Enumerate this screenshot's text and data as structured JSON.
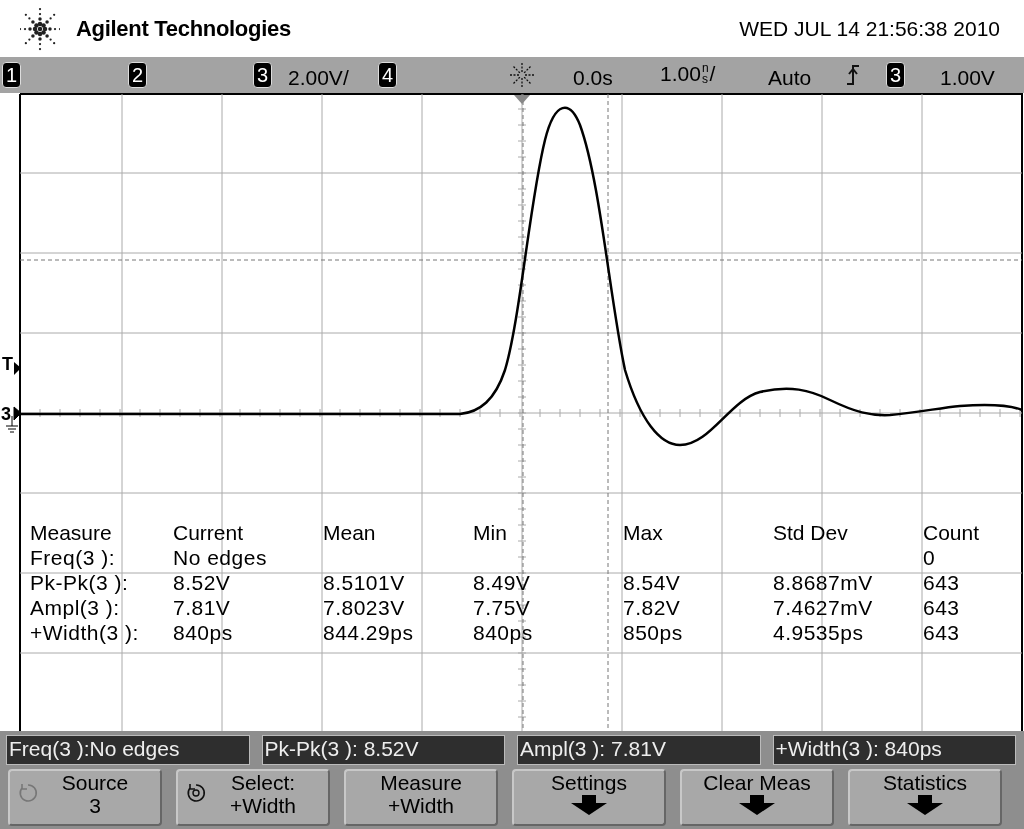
{
  "header": {
    "brand": "Agilent Technologies",
    "datetime": "WED JUL 14 21:56:38 2010"
  },
  "status_bar": {
    "channels": [
      {
        "label": "1"
      },
      {
        "label": "2"
      },
      {
        "label": "3",
        "scale": "2.00V/"
      },
      {
        "label": "4"
      }
    ],
    "time_offset": "0.0s",
    "time_scale": {
      "value": "1.00",
      "prefix": "n",
      "unit": "s",
      "suffix": "/"
    },
    "trigger_mode": "Auto",
    "trigger_source": "3",
    "trigger_level": "1.00V"
  },
  "graticule": {
    "trigger_marker": "T",
    "channel_marker": "3"
  },
  "measurements": {
    "columns": [
      "Measure",
      "Current",
      "Mean",
      "Min",
      "Max",
      "Std Dev",
      "Count"
    ],
    "rows": [
      [
        "Freq(3 ):",
        "No edges",
        null,
        null,
        null,
        null,
        "0"
      ],
      [
        "Pk-Pk(3 ):",
        "8.52V",
        "8.5101V",
        "8.49V",
        "8.54V",
        "8.8687mV",
        "643"
      ],
      [
        "Ampl(3 ):",
        "7.81V",
        "7.8023V",
        "7.75V",
        "7.82V",
        "7.4627mV",
        "643"
      ],
      [
        "+Width(3 ):",
        "840ps",
        "844.29ps",
        "840ps",
        "850ps",
        "4.9535ps",
        "643"
      ]
    ]
  },
  "readouts": [
    "Freq(3 ):No edges",
    "Pk-Pk(3 ): 8.52V",
    "Ampl(3 ): 7.81V",
    "+Width(3 ): 840ps"
  ],
  "softkeys": [
    {
      "kind": "knob-dim",
      "line1": "Source",
      "line2": "3"
    },
    {
      "kind": "knob",
      "line1": "Select:",
      "line2": "+Width"
    },
    {
      "kind": "plain",
      "line1": "Measure",
      "line2": "+Width"
    },
    {
      "kind": "menu",
      "line1": "Settings"
    },
    {
      "kind": "menu",
      "line1": "Clear Meas"
    },
    {
      "kind": "menu",
      "line1": "Statistics"
    }
  ]
}
